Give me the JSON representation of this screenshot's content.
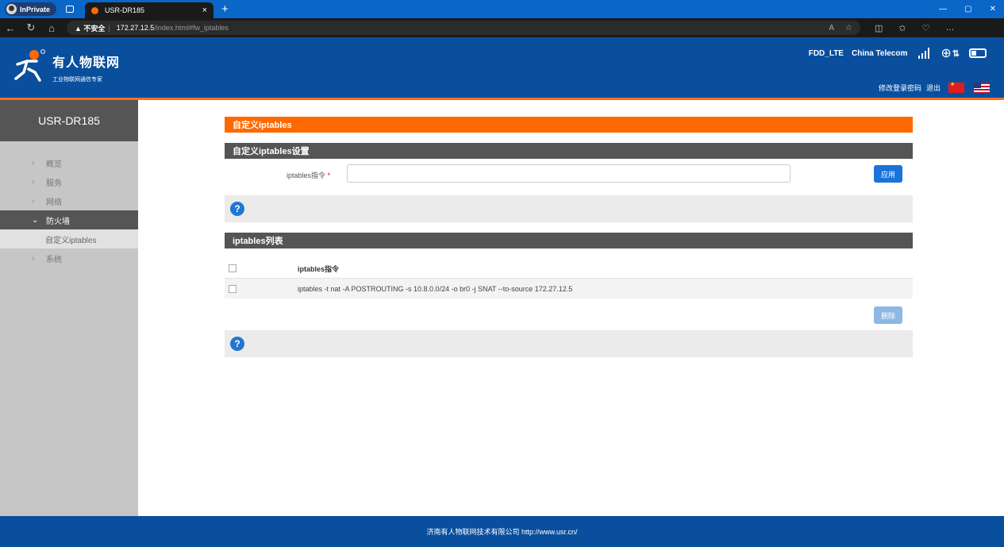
{
  "browser": {
    "inprivate_label": "InPrivate",
    "tab_title": "USR-DR185",
    "tab_close": "×",
    "new_tab": "+",
    "window_controls": [
      "—",
      "▢",
      "✕"
    ],
    "security_warning": "▲ 不安全",
    "url_host": "172.27.12.5",
    "url_path": "/index.html#fw_iptables"
  },
  "header": {
    "brand_name": "有人物联网",
    "brand_slogan": "工业物联网通信专家",
    "network_type": "FDD_LTE",
    "carrier": "China Telecom",
    "signal_level": 4,
    "link_change_password": "修改登录密码",
    "link_logout": "退出"
  },
  "sidebar": {
    "device_name": "USR-DR185",
    "items": [
      {
        "label": "概览",
        "chevron": "›"
      },
      {
        "label": "服务",
        "chevron": "›"
      },
      {
        "label": "网络",
        "chevron": "›"
      },
      {
        "label": "防火墙",
        "chevron": "⌄"
      },
      {
        "label": "自定义iptables"
      },
      {
        "label": "系统",
        "chevron": "›"
      }
    ]
  },
  "main": {
    "page_title": "自定义iptables",
    "settings_title": "自定义iptables设置",
    "command_label": "iptables指令",
    "required_mark": "*",
    "command_value": "",
    "apply_button": "应用",
    "help_icon": "?",
    "list_title": "iptables列表",
    "table_header": "iptables指令",
    "rows": [
      "iptables -t nat -A POSTROUTING -s 10.8.0.0/24 -o br0 -j SNAT --to-source 172.27.12.5"
    ],
    "delete_button": "删除"
  },
  "footer": {
    "text": "济南有人物联网技术有限公司  http://www.usr.cn/"
  },
  "colors": {
    "header_blue": "#0a4f9e",
    "accent_orange": "#ff6a00",
    "section_dark": "#555555",
    "button_blue": "#1a73d9",
    "button_disabled": "#8db8e3"
  }
}
